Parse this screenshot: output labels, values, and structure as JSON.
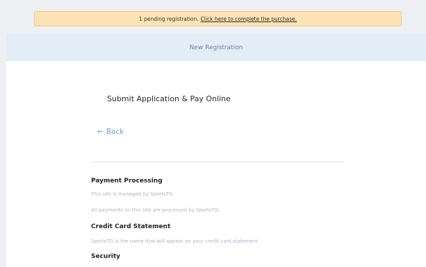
{
  "notice": {
    "text": "1 pending registration.",
    "link_text": "Click here to complete the purchase."
  },
  "header": {
    "title": "New Registration"
  },
  "main": {
    "title": "Submit Application & Pay Online",
    "back_arrow": "←",
    "back_label": "Back",
    "sections": [
      {
        "heading": "Payment Processing",
        "lines": [
          "This site is managed by SportsTG.",
          "All payments on this site are processed by SportsTG."
        ]
      },
      {
        "heading": "Credit Card Statement",
        "lines": [
          "SportsTG is the name that will appear on your credit card statement."
        ]
      },
      {
        "heading": "Security",
        "lines": []
      }
    ]
  }
}
